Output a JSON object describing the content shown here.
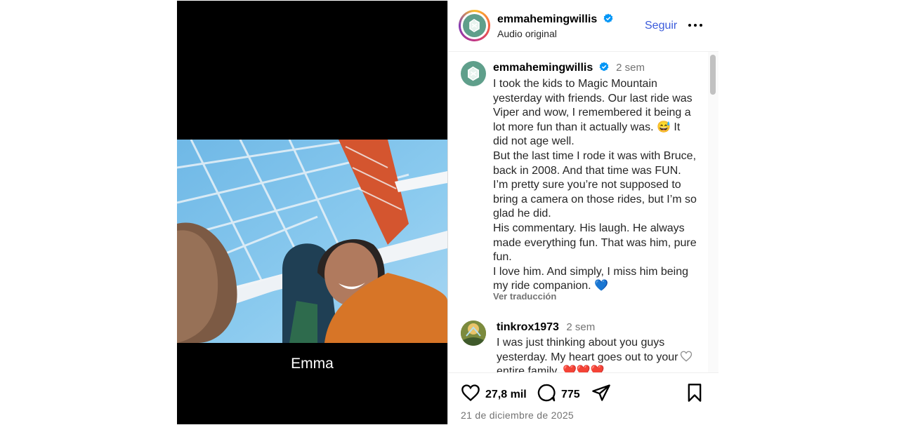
{
  "media": {
    "overlay_caption": "Emma"
  },
  "header": {
    "username": "emmahemingwillis",
    "subtitle": "Audio original",
    "follow_label": "Seguir",
    "more_icon": "more-options-icon"
  },
  "caption": {
    "author": "emmahemingwillis",
    "time": "2 sem",
    "text": "I took the kids to Magic Mountain yesterday with friends. Our last ride was Viper and wow, I remembered it being a lot more fun than it actually was. 😅 It did not age well.\nBut the last time I rode it was with Bruce, back in 2008. And that time was FUN. I’m pretty sure you’re not supposed to bring a camera on those rides, but I’m so glad he did.\nHis commentary. His laugh. He always made everything fun. That was him, pure fun.\nI love him. And simply, I miss him being my ride companion. 💙",
    "translate_label": "Ver traducción"
  },
  "comments": [
    {
      "author": "tinkrox1973",
      "time": "2 sem",
      "text": "I was just thinking about you guys yesterday. My heart goes out to your entire family. ❤️❤️❤️"
    }
  ],
  "footer": {
    "likes": "27,8 mil",
    "comments": "775",
    "date": "21 de diciembre de 2025"
  },
  "colors": {
    "accent": "#3b5bdb",
    "verified": "#0095f6",
    "muted": "#737373"
  }
}
